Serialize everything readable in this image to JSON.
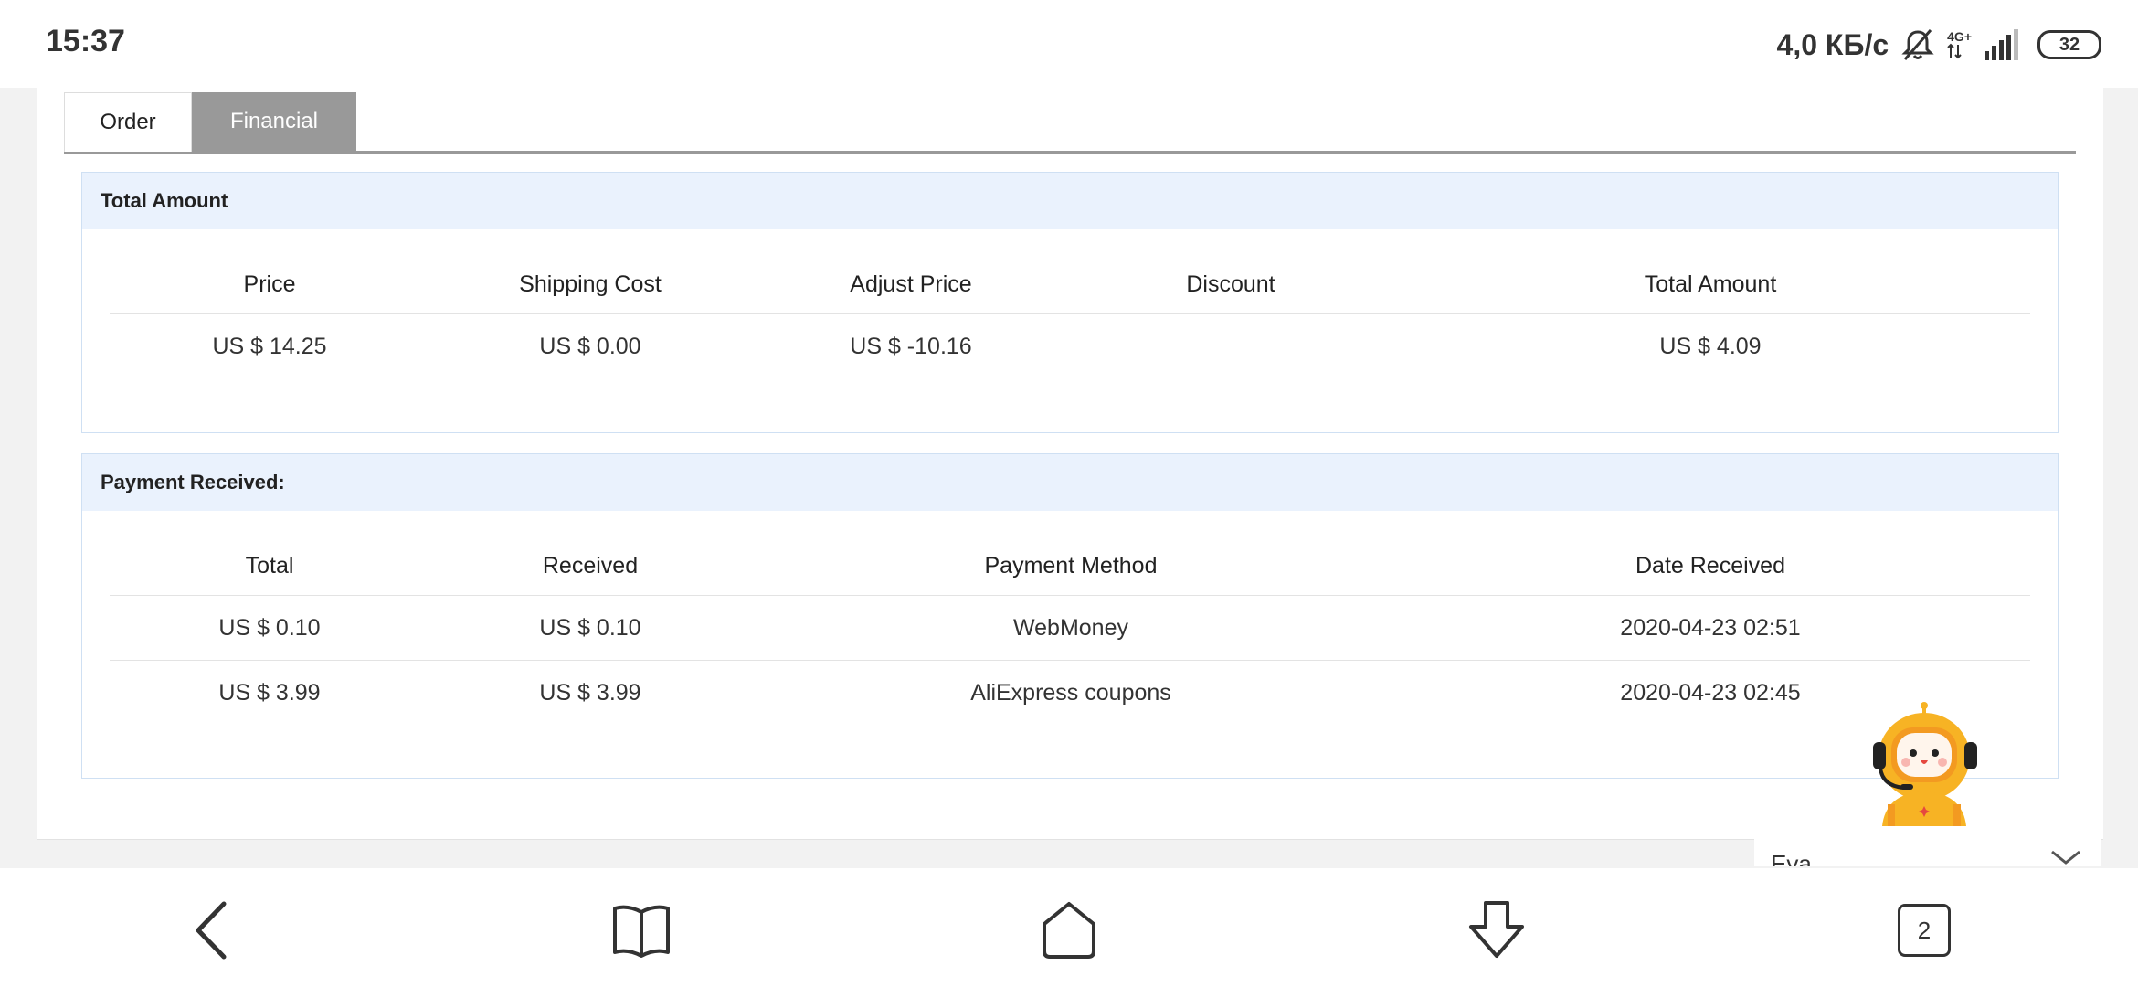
{
  "status_bar": {
    "time": "15:37",
    "net_speed": "4,0 КБ/с",
    "network_type": "4G+",
    "battery": "32"
  },
  "tabs": [
    {
      "label": "Order",
      "active": false
    },
    {
      "label": "Financial",
      "active": true
    }
  ],
  "total_amount": {
    "title": "Total Amount",
    "headers": [
      "Price",
      "Shipping Cost",
      "Adjust Price",
      "Discount",
      "Total Amount"
    ],
    "rows": [
      [
        "US $ 14.25",
        "US $ 0.00",
        "US $ -10.16",
        "",
        "US $ 4.09"
      ]
    ]
  },
  "payment_received": {
    "title": "Payment Received:",
    "headers": [
      "Total",
      "Received",
      "Payment Method",
      "Date Received"
    ],
    "rows": [
      [
        "US $ 0.10",
        "US $ 0.10",
        "WebMoney",
        "2020-04-23 02:51"
      ],
      [
        "US $ 3.99",
        "US $ 3.99",
        "AliExpress coupons",
        "2020-04-23 02:45"
      ]
    ]
  },
  "chat_widget": {
    "name": "Eva",
    "mascot_icon": "robot-assistant-icon"
  },
  "nav_bar": {
    "tabs_count": "2"
  },
  "colors": {
    "section_header_bg": "#eaf2fd",
    "active_tab_bg": "#999999",
    "mascot_yellow": "#f7b324"
  }
}
